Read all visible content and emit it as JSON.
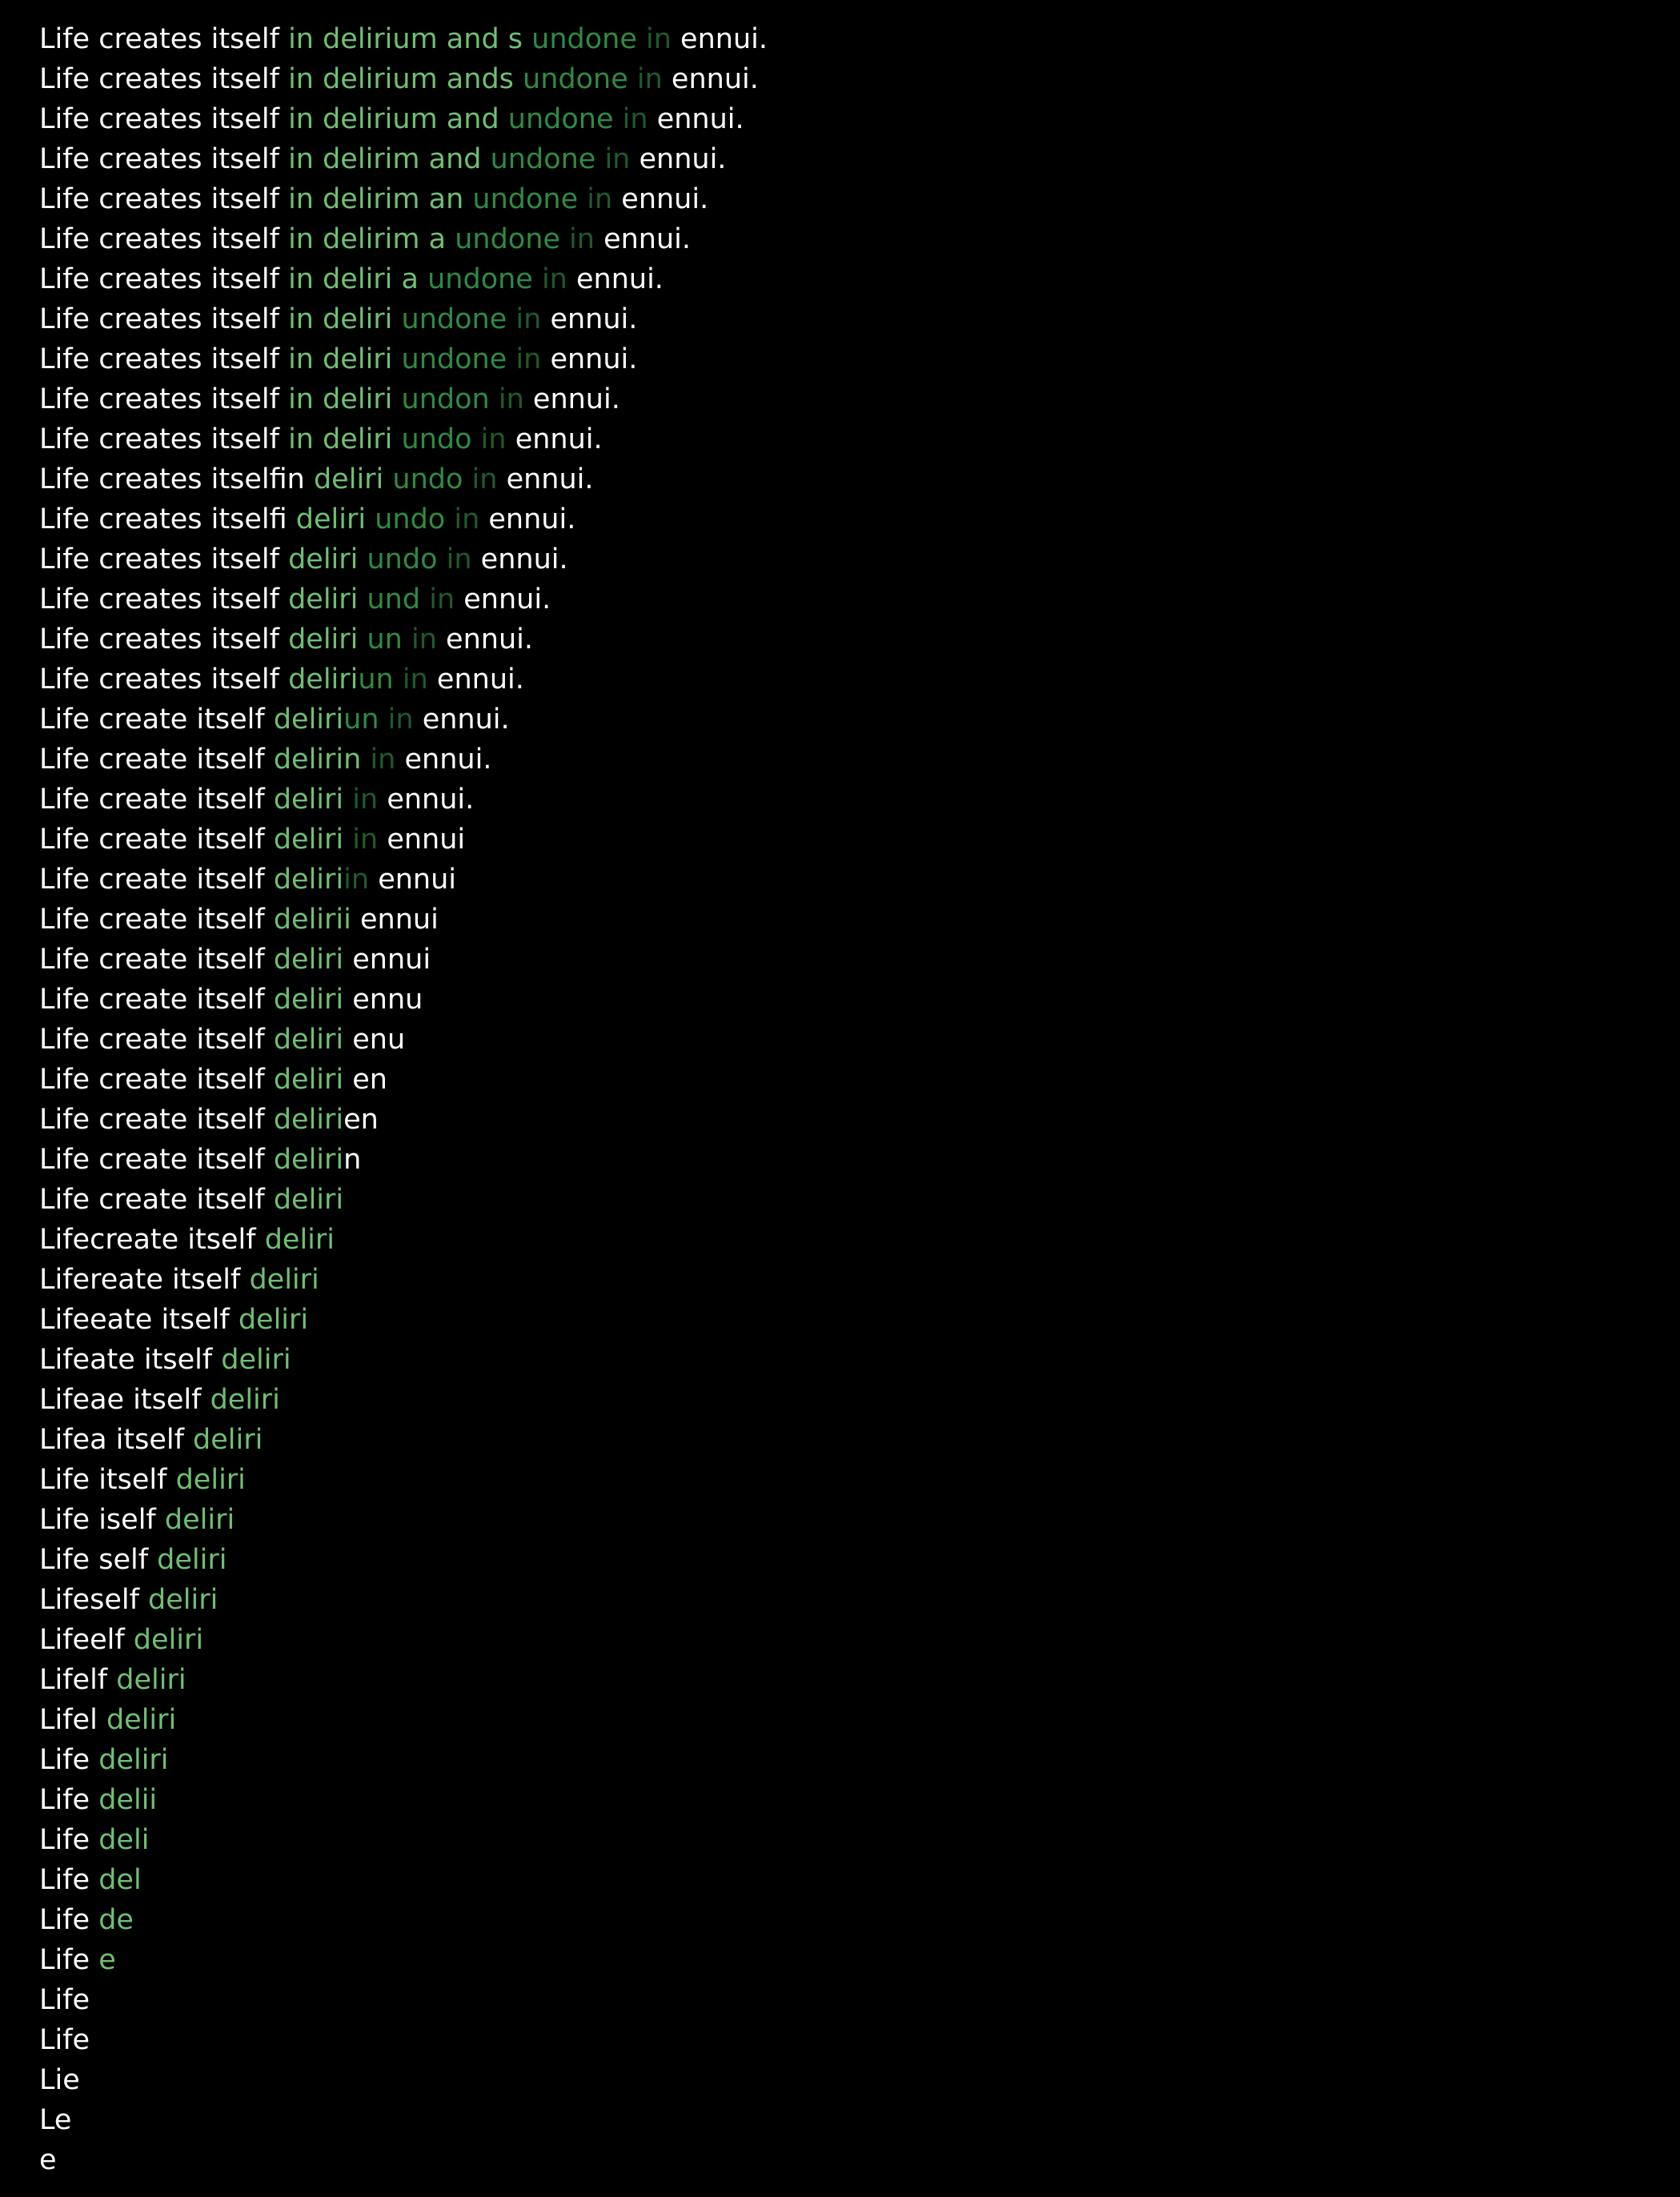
{
  "colors": {
    "w": "#ffffff",
    "l": "#b9e3b9",
    "g": "#6fbf73",
    "d": "#2f8a44",
    "k": "#1f5a2c"
  },
  "lines": [
    [
      [
        "w",
        "Life creates itself "
      ],
      [
        "g",
        "in delirium and s "
      ],
      [
        "d",
        "undone "
      ],
      [
        "k",
        "in "
      ],
      [
        "w",
        "ennui."
      ]
    ],
    [
      [
        "w",
        "Life creates itself "
      ],
      [
        "g",
        "in delirium ands "
      ],
      [
        "d",
        "undone "
      ],
      [
        "k",
        "in "
      ],
      [
        "w",
        "ennui."
      ]
    ],
    [
      [
        "w",
        "Life creates itself "
      ],
      [
        "g",
        "in delirium and "
      ],
      [
        "d",
        "undone "
      ],
      [
        "k",
        "in "
      ],
      [
        "w",
        "ennui."
      ]
    ],
    [
      [
        "w",
        "Life creates itself "
      ],
      [
        "g",
        "in delirim and "
      ],
      [
        "d",
        "undone "
      ],
      [
        "k",
        "in "
      ],
      [
        "w",
        "ennui."
      ]
    ],
    [
      [
        "w",
        "Life creates itself "
      ],
      [
        "g",
        "in delirim an "
      ],
      [
        "d",
        "undone "
      ],
      [
        "k",
        "in "
      ],
      [
        "w",
        "ennui."
      ]
    ],
    [
      [
        "w",
        "Life creates itself "
      ],
      [
        "g",
        "in delirim a "
      ],
      [
        "d",
        "undone "
      ],
      [
        "k",
        "in "
      ],
      [
        "w",
        "ennui."
      ]
    ],
    [
      [
        "w",
        "Life creates itself "
      ],
      [
        "g",
        "in deliri a "
      ],
      [
        "d",
        "undone "
      ],
      [
        "k",
        "in "
      ],
      [
        "w",
        "ennui."
      ]
    ],
    [
      [
        "w",
        "Life creates itself "
      ],
      [
        "g",
        "in deliri "
      ],
      [
        "d",
        "undone "
      ],
      [
        "k",
        "in "
      ],
      [
        "w",
        "ennui."
      ]
    ],
    [
      [
        "w",
        "Life creates itself "
      ],
      [
        "g",
        "in deliri "
      ],
      [
        "d",
        "undone "
      ],
      [
        "k",
        "in "
      ],
      [
        "w",
        "ennui."
      ]
    ],
    [
      [
        "w",
        "Life creates itself "
      ],
      [
        "g",
        "in deliri "
      ],
      [
        "d",
        "undon "
      ],
      [
        "k",
        "in "
      ],
      [
        "w",
        "ennui."
      ]
    ],
    [
      [
        "w",
        "Life creates itself "
      ],
      [
        "g",
        "in deliri "
      ],
      [
        "d",
        "undo "
      ],
      [
        "k",
        "in "
      ],
      [
        "w",
        "ennui."
      ]
    ],
    [
      [
        "w",
        "Life creates itselfin "
      ],
      [
        "g",
        "deliri "
      ],
      [
        "d",
        "undo "
      ],
      [
        "k",
        "in "
      ],
      [
        "w",
        "ennui."
      ]
    ],
    [
      [
        "w",
        "Life creates itselfi "
      ],
      [
        "g",
        "deliri "
      ],
      [
        "d",
        "undo "
      ],
      [
        "k",
        "in "
      ],
      [
        "w",
        "ennui."
      ]
    ],
    [
      [
        "w",
        "Life creates itself "
      ],
      [
        "g",
        "deliri "
      ],
      [
        "d",
        "undo "
      ],
      [
        "k",
        "in "
      ],
      [
        "w",
        "ennui."
      ]
    ],
    [
      [
        "w",
        "Life creates itself "
      ],
      [
        "g",
        "deliri "
      ],
      [
        "d",
        "und "
      ],
      [
        "k",
        "in "
      ],
      [
        "w",
        "ennui."
      ]
    ],
    [
      [
        "w",
        "Life creates itself "
      ],
      [
        "g",
        "deliri "
      ],
      [
        "d",
        "un "
      ],
      [
        "k",
        "in "
      ],
      [
        "w",
        "ennui."
      ]
    ],
    [
      [
        "w",
        "Life creates itself "
      ],
      [
        "g",
        "deliri"
      ],
      [
        "d",
        "un "
      ],
      [
        "k",
        "in "
      ],
      [
        "w",
        "ennui."
      ]
    ],
    [
      [
        "w",
        "Life create itself "
      ],
      [
        "g",
        "deliri"
      ],
      [
        "d",
        "un "
      ],
      [
        "k",
        "in "
      ],
      [
        "w",
        "ennui."
      ]
    ],
    [
      [
        "w",
        "Life create itself "
      ],
      [
        "g",
        "delirin "
      ],
      [
        "k",
        "in "
      ],
      [
        "w",
        "ennui."
      ]
    ],
    [
      [
        "w",
        "Life create itself "
      ],
      [
        "g",
        "deliri "
      ],
      [
        "k",
        "in "
      ],
      [
        "w",
        "ennui."
      ]
    ],
    [
      [
        "w",
        "Life create itself "
      ],
      [
        "g",
        "deliri "
      ],
      [
        "k",
        "in "
      ],
      [
        "w",
        "ennui"
      ]
    ],
    [
      [
        "w",
        "Life create itself "
      ],
      [
        "g",
        "deliri"
      ],
      [
        "k",
        "in "
      ],
      [
        "w",
        "ennui"
      ]
    ],
    [
      [
        "w",
        "Life create itself "
      ],
      [
        "g",
        "delirii "
      ],
      [
        "w",
        "ennui"
      ]
    ],
    [
      [
        "w",
        "Life create itself "
      ],
      [
        "g",
        "deliri "
      ],
      [
        "w",
        "ennui"
      ]
    ],
    [
      [
        "w",
        "Life create itself "
      ],
      [
        "g",
        "deliri "
      ],
      [
        "w",
        "ennu"
      ]
    ],
    [
      [
        "w",
        "Life create itself "
      ],
      [
        "g",
        "deliri "
      ],
      [
        "w",
        "enu"
      ]
    ],
    [
      [
        "w",
        "Life create itself "
      ],
      [
        "g",
        "deliri "
      ],
      [
        "w",
        "en"
      ]
    ],
    [
      [
        "w",
        "Life create itself "
      ],
      [
        "g",
        "deliri"
      ],
      [
        "w",
        "en"
      ]
    ],
    [
      [
        "w",
        "Life create itself "
      ],
      [
        "g",
        "deliri"
      ],
      [
        "w",
        "n"
      ]
    ],
    [
      [
        "w",
        "Life create itself "
      ],
      [
        "g",
        "deliri"
      ]
    ],
    [
      [
        "w",
        "Lifecreate itself "
      ],
      [
        "g",
        "deliri"
      ]
    ],
    [
      [
        "w",
        "Lifereate itself "
      ],
      [
        "g",
        "deliri"
      ]
    ],
    [
      [
        "w",
        "Lifeeate itself "
      ],
      [
        "g",
        "deliri"
      ]
    ],
    [
      [
        "w",
        "Lifeate itself "
      ],
      [
        "g",
        "deliri"
      ]
    ],
    [
      [
        "w",
        "Lifeae itself "
      ],
      [
        "g",
        "deliri"
      ]
    ],
    [
      [
        "w",
        "Lifea itself "
      ],
      [
        "g",
        "deliri"
      ]
    ],
    [
      [
        "w",
        "Life itself "
      ],
      [
        "g",
        "deliri"
      ]
    ],
    [
      [
        "w",
        "Life iself "
      ],
      [
        "g",
        "deliri"
      ]
    ],
    [
      [
        "w",
        "Life self "
      ],
      [
        "g",
        "deliri"
      ]
    ],
    [
      [
        "w",
        "Lifeself "
      ],
      [
        "g",
        "deliri"
      ]
    ],
    [
      [
        "w",
        "Lifeelf "
      ],
      [
        "g",
        "deliri"
      ]
    ],
    [
      [
        "w",
        "Lifelf "
      ],
      [
        "g",
        "deliri"
      ]
    ],
    [
      [
        "w",
        "Lifel "
      ],
      [
        "g",
        "deliri"
      ]
    ],
    [
      [
        "w",
        "Life "
      ],
      [
        "g",
        "deliri"
      ]
    ],
    [
      [
        "w",
        "Life "
      ],
      [
        "g",
        "delii"
      ]
    ],
    [
      [
        "w",
        "Life "
      ],
      [
        "g",
        "deli"
      ]
    ],
    [
      [
        "w",
        "Life "
      ],
      [
        "g",
        "del"
      ]
    ],
    [
      [
        "w",
        "Life "
      ],
      [
        "g",
        "de"
      ]
    ],
    [
      [
        "w",
        "Life "
      ],
      [
        "g",
        "e"
      ]
    ],
    [
      [
        "w",
        "Life"
      ]
    ],
    [
      [
        "w",
        "Life"
      ]
    ],
    [
      [
        "w",
        "Lie"
      ]
    ],
    [
      [
        "w",
        "Le"
      ]
    ],
    [
      [
        "w",
        "e"
      ]
    ]
  ]
}
